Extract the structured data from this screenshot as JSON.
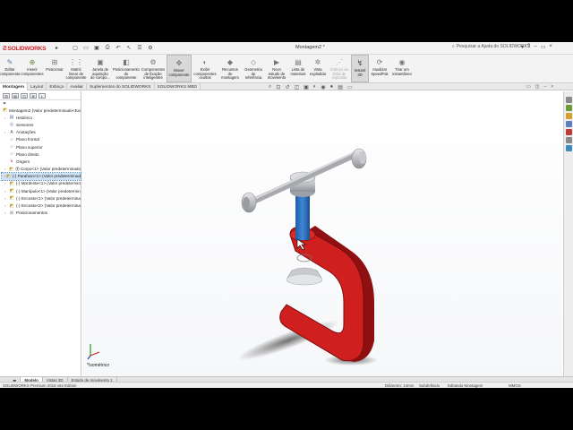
{
  "app": {
    "logo": "SOLIDWORKS",
    "document_title": "Montagem2 *"
  },
  "quick_access": [
    "new-icon",
    "open-icon",
    "save-icon",
    "print-icon",
    "undo-icon",
    "select-icon",
    "rebuild-icon",
    "options-icon"
  ],
  "search": {
    "placeholder": "Pesquisar a Ajuda do SOLIDWORKS"
  },
  "commands": [
    {
      "label": "Editar\ncomponente",
      "icon": "✎",
      "color": "#5577aa"
    },
    {
      "label": "Inserir\ncomponentes",
      "icon": "⊕",
      "color": "#6a8a3a"
    },
    {
      "label": "Posicionar",
      "icon": "⊞",
      "color": "#777"
    },
    {
      "label": "Matriz\nlinear de\ncomponente",
      "icon": "⋮⋮",
      "color": "#777"
    },
    {
      "label": "Janela de\naquisição\nde compo...",
      "icon": "▣",
      "color": "#777"
    },
    {
      "label": "Posicionamento\nde\ncomponente",
      "icon": "◧",
      "color": "#777"
    },
    {
      "label": "Componentes\nde fixação\ninteligentes",
      "icon": "⚙",
      "color": "#777"
    },
    {
      "label": "Mover\ncomponente",
      "icon": "✥",
      "color": "#777",
      "active": true
    },
    {
      "label": "Exibir\ncomponentes\nocultos",
      "icon": "◐",
      "color": "#777"
    },
    {
      "label": "Recursos\nde\nmontagem",
      "icon": "◆",
      "color": "#777"
    },
    {
      "label": "Geometria\nde\nreferência",
      "icon": "◇",
      "color": "#777"
    },
    {
      "label": "Novo\nestudo de\nmovimento",
      "icon": "▶",
      "color": "#777"
    },
    {
      "label": "Lista de\nmateriais",
      "icon": "▤",
      "color": "#777"
    },
    {
      "label": "Vista\nexplodida",
      "icon": "✲",
      "color": "#777"
    },
    {
      "label": "Esboço da\nlinha de\nexplosão",
      "icon": "⋰",
      "color": "#aaa",
      "dim": true
    },
    {
      "label": "Instant\n3D",
      "icon": "↯",
      "color": "#444",
      "active": true
    },
    {
      "label": "Atualizar\nSpeedPak",
      "icon": "⟳",
      "color": "#777"
    },
    {
      "label": "Tirar um\ninstantâneo",
      "icon": "◉",
      "color": "#777"
    }
  ],
  "command_tabs": [
    "Montagem",
    "Layout",
    "Esboço",
    "Avaliar",
    "Suplementos do SOLIDWORKS",
    "SOLIDWORKS MBD"
  ],
  "active_command_tab": "Montagem",
  "feature_tree": {
    "filter_icon": "filter-icon",
    "nodes": [
      {
        "label": "Montagem2  (Valor predeterminado<Exi",
        "icon": "◩",
        "color": "#c9a13c",
        "exp": ""
      },
      {
        "label": "Histórico",
        "icon": "▤",
        "color": "#6a7fa8",
        "exp": "›"
      },
      {
        "label": "Sensores",
        "icon": "◎",
        "color": "#5a7fa0",
        "exp": ""
      },
      {
        "label": "Anotações",
        "icon": "A",
        "color": "#555",
        "exp": "›"
      },
      {
        "label": "Plano frontal",
        "icon": "▱",
        "color": "#7a8aa8",
        "exp": ""
      },
      {
        "label": "Plano superior",
        "icon": "▱",
        "color": "#7a8aa8",
        "exp": ""
      },
      {
        "label": "Plano direito",
        "icon": "▱",
        "color": "#7a8aa8",
        "exp": ""
      },
      {
        "label": "Origem",
        "icon": "↳",
        "color": "#b04040",
        "exp": ""
      },
      {
        "label": "(f) Corpo<1> (Valor predeterminado",
        "icon": "◩",
        "color": "#c9a13c",
        "exp": "›"
      },
      {
        "label": "(-) Parafuso<1> (Valor predeterminad",
        "icon": "◩",
        "color": "#c9a13c",
        "exp": "›",
        "selected": true
      },
      {
        "label": "(-) Mordente<1> (Valor predetermin",
        "icon": "◩",
        "color": "#c9a13c",
        "exp": "›"
      },
      {
        "label": "(-) Manípulo<1> (Valor predetermin",
        "icon": "◩",
        "color": "#c9a13c",
        "exp": "›"
      },
      {
        "label": "(-) Encosto<1> (Valor predetermina",
        "icon": "◩",
        "color": "#c9a13c",
        "exp": "›"
      },
      {
        "label": "(-) Encosto<2> (Valor predetermina",
        "icon": "◩",
        "color": "#c9a13c",
        "exp": "›"
      },
      {
        "label": "Posicionamentos",
        "icon": "⊞",
        "color": "#777",
        "exp": "›"
      }
    ]
  },
  "viewport": {
    "view_name": "*Isométrico"
  },
  "bottom_tabs": [
    "Modelo",
    "Vistas 3D",
    "Estudo de movimento 1"
  ],
  "active_bottom_tab": "Modelo",
  "status": {
    "edition": "SOLIDWORKS Premium 2016 x64 Edition",
    "diameter": "Diâmetro: 14mm",
    "state": "Subdefinido",
    "mode": "Editando Montagem",
    "units": "MMGS"
  },
  "colors": {
    "frame_red": "#cf1f1f",
    "screw_blue": "#2a6fc0",
    "accent_red": "#d2232a"
  }
}
